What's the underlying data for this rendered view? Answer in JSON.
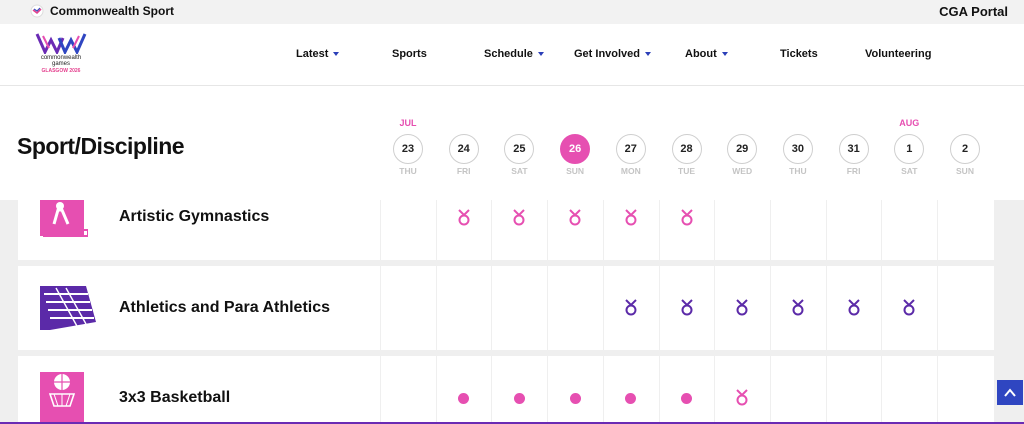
{
  "topbar": {
    "brand": "Commonwealth Sport",
    "portal": "CGA Portal"
  },
  "logo": {
    "line1": "commonwealth",
    "line2": "games",
    "line3": "GLASGOW 2026"
  },
  "nav": [
    {
      "label": "Latest",
      "dropdown": true
    },
    {
      "label": "Sports",
      "dropdown": false
    },
    {
      "label": "Schedule",
      "dropdown": true
    },
    {
      "label": "Get Involved",
      "dropdown": true
    },
    {
      "label": "About",
      "dropdown": true
    },
    {
      "label": "Tickets",
      "dropdown": false
    },
    {
      "label": "Volunteering",
      "dropdown": false
    }
  ],
  "page_title": "Sport/Discipline",
  "months": [
    {
      "label": "JUL",
      "day_index": 0
    },
    {
      "label": "AUG",
      "day_index": 9
    }
  ],
  "days": [
    {
      "date": "23",
      "dow": "THU"
    },
    {
      "date": "24",
      "dow": "FRI"
    },
    {
      "date": "25",
      "dow": "SAT"
    },
    {
      "date": "26",
      "dow": "SUN",
      "active": true
    },
    {
      "date": "27",
      "dow": "MON"
    },
    {
      "date": "28",
      "dow": "TUE"
    },
    {
      "date": "29",
      "dow": "WED"
    },
    {
      "date": "30",
      "dow": "THU"
    },
    {
      "date": "31",
      "dow": "FRI"
    },
    {
      "date": "1",
      "dow": "SAT"
    },
    {
      "date": "2",
      "dow": "SUN"
    }
  ],
  "sports": [
    {
      "name": "Artistic Gymnastics",
      "icon": "artistic-gymnastics-icon",
      "color": "#e64fb1",
      "schedule": [
        "",
        "medal",
        "medal",
        "medal",
        "medal",
        "medal",
        "",
        "",
        "",
        "",
        ""
      ]
    },
    {
      "name": "Athletics and Para Athletics",
      "icon": "athletics-icon",
      "color": "#5b2aa8",
      "schedule": [
        "",
        "",
        "",
        "",
        "medal",
        "medal",
        "medal",
        "medal",
        "medal",
        "medal",
        ""
      ]
    },
    {
      "name": "3x3 Basketball",
      "icon": "basketball-icon",
      "color": "#e64fb1",
      "schedule": [
        "",
        "event",
        "event",
        "event",
        "event",
        "event",
        "medal",
        "",
        "",
        "",
        ""
      ]
    }
  ],
  "colors": {
    "pink": "#e64fb1",
    "purple": "#5b2aa8",
    "blue": "#2f46c1"
  },
  "icons": {
    "medal": "medal-icon",
    "event": "event-dot-icon",
    "back_to_top": "chevron-up-icon"
  }
}
